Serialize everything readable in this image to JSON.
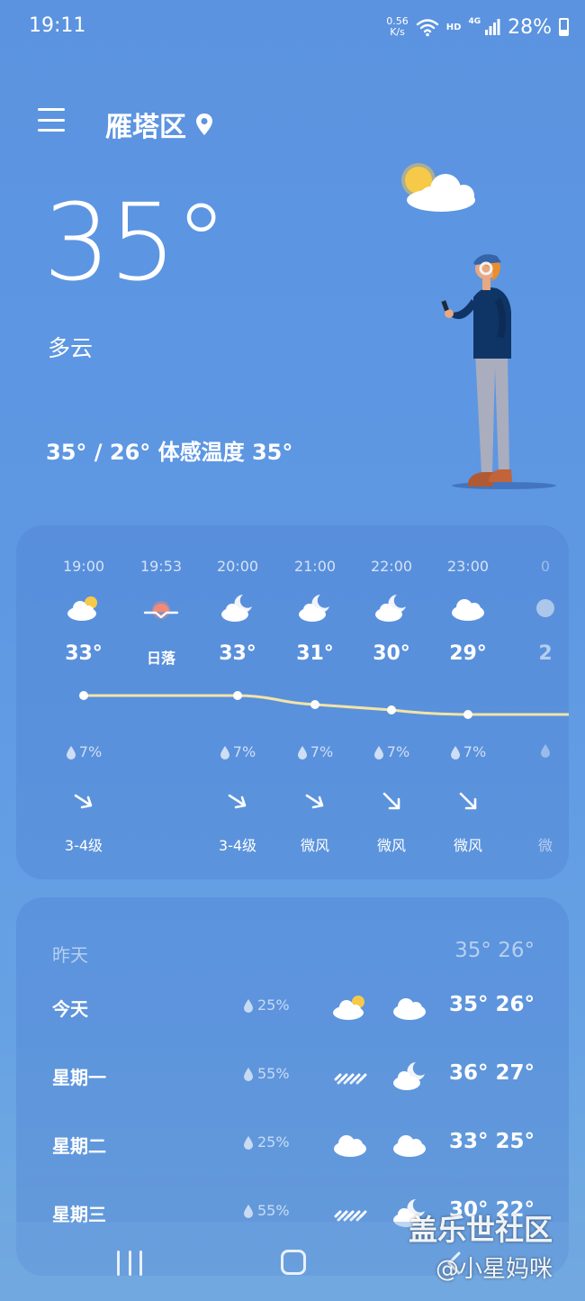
{
  "status_bar": {
    "time": "19:11",
    "net_speed_value": "0.56",
    "net_speed_unit": "K/s",
    "hd_label": "HD",
    "network_label": "4G",
    "battery": "28%"
  },
  "header": {
    "city": "雁塔区",
    "menu_icon": "hamburger-menu-icon",
    "location_icon": "location-pin-icon"
  },
  "current": {
    "temperature": "35°",
    "condition": "多云",
    "hi_lo_feels": "35° / 26° 体感温度 35°"
  },
  "hourly": [
    {
      "time": "19:00",
      "icon": "partly-cloudy-day",
      "temp": "33°",
      "rain": "7%",
      "wind_dir": "se",
      "wind": "3-4级"
    },
    {
      "time": "19:53",
      "icon": "sunset",
      "temp": "日落",
      "rain": "",
      "wind_dir": "",
      "wind": ""
    },
    {
      "time": "20:00",
      "icon": "partly-cloudy-night",
      "temp": "33°",
      "rain": "7%",
      "wind_dir": "se",
      "wind": "3-4级"
    },
    {
      "time": "21:00",
      "icon": "partly-cloudy-night",
      "temp": "31°",
      "rain": "7%",
      "wind_dir": "se",
      "wind": "微风"
    },
    {
      "time": "22:00",
      "icon": "partly-cloudy-night",
      "temp": "30°",
      "rain": "7%",
      "wind_dir": "s",
      "wind": "微风"
    },
    {
      "time": "23:00",
      "icon": "cloudy",
      "temp": "29°",
      "rain": "7%",
      "wind_dir": "s",
      "wind": "微风"
    },
    {
      "time": "0",
      "icon": "partial",
      "temp": "2",
      "rain": "",
      "wind_dir": "",
      "wind": "微"
    }
  ],
  "daily": [
    {
      "day": "昨天",
      "pct": "",
      "icon_day": "",
      "icon_night": "",
      "temps": "35° 26°",
      "yesterday": true
    },
    {
      "day": "今天",
      "pct": "25%",
      "icon_day": "partly-cloudy-day",
      "icon_night": "cloudy",
      "temps": "35° 26°"
    },
    {
      "day": "星期一",
      "pct": "55%",
      "icon_day": "rain",
      "icon_night": "partly-cloudy-night",
      "temps": "36° 27°"
    },
    {
      "day": "星期二",
      "pct": "25%",
      "icon_day": "cloudy",
      "icon_night": "cloudy",
      "temps": "33° 25°"
    },
    {
      "day": "星期三",
      "pct": "55%",
      "icon_day": "rain",
      "icon_night": "partly-cloudy-night",
      "temps": "30° 22°"
    }
  ],
  "nav": {
    "recents": "recents-icon",
    "home": "home-icon",
    "back": "back-icon"
  },
  "watermark": {
    "line1": "盖乐世社区",
    "line2": "@小星妈咪"
  },
  "colors": {
    "background": "#5e98e3",
    "card": "#5082d2",
    "sun": "#f7c948",
    "sunset": "#f08a7a",
    "line": "#f3e3a8"
  }
}
